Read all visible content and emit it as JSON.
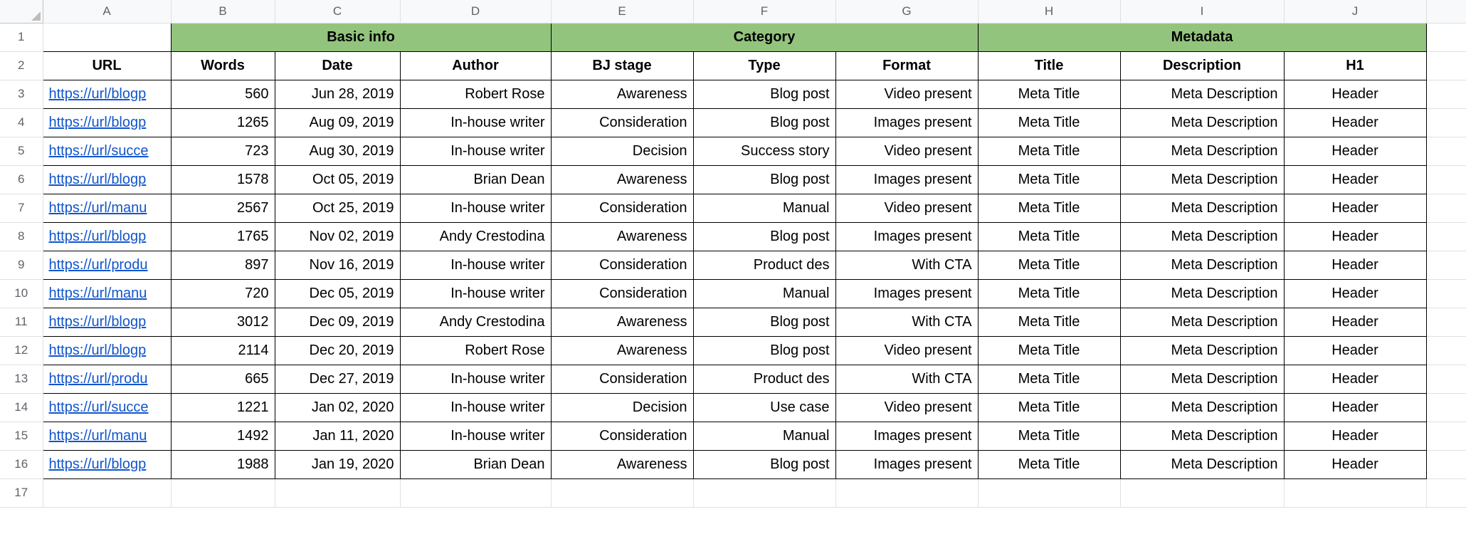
{
  "columns": [
    "A",
    "B",
    "C",
    "D",
    "E",
    "F",
    "G",
    "H",
    "I",
    "J"
  ],
  "groups": [
    {
      "label": "Basic info",
      "span": 3
    },
    {
      "label": "Category",
      "span": 3
    },
    {
      "label": "Metadata",
      "span": 3
    }
  ],
  "headers": {
    "url": "URL",
    "words": "Words",
    "date": "Date",
    "author": "Author",
    "bj_stage": "BJ stage",
    "type": "Type",
    "format": "Format",
    "title": "Title",
    "description": "Description",
    "h1": "H1"
  },
  "chart_data": {
    "type": "table",
    "columns": [
      "URL",
      "Words",
      "Date",
      "Author",
      "BJ stage",
      "Type",
      "Format",
      "Title",
      "Description",
      "H1"
    ],
    "rows": [
      {
        "url": "https://url/blogp",
        "words": 560,
        "date": "Jun 28, 2019",
        "author": "Robert Rose",
        "bj_stage": "Awareness",
        "type": "Blog post",
        "format": "Video present",
        "title": "Meta Title",
        "description": "Meta Description",
        "h1": "Header"
      },
      {
        "url": "https://url/blogp",
        "words": 1265,
        "date": "Aug 09, 2019",
        "author": "In-house writer",
        "bj_stage": "Consideration",
        "type": "Blog post",
        "format": "Images present",
        "title": "Meta Title",
        "description": "Meta Description",
        "h1": "Header"
      },
      {
        "url": "https://url/succe",
        "words": 723,
        "date": "Aug 30, 2019",
        "author": "In-house writer",
        "bj_stage": "Decision",
        "type": "Success story",
        "format": "Video present",
        "title": "Meta Title",
        "description": "Meta Description",
        "h1": "Header"
      },
      {
        "url": "https://url/blogp",
        "words": 1578,
        "date": "Oct 05, 2019",
        "author": "Brian Dean",
        "bj_stage": "Awareness",
        "type": "Blog post",
        "format": "Images present",
        "title": "Meta Title",
        "description": "Meta Description",
        "h1": "Header"
      },
      {
        "url": "https://url/manu",
        "words": 2567,
        "date": "Oct 25, 2019",
        "author": "In-house writer",
        "bj_stage": "Consideration",
        "type": "Manual",
        "format": "Video present",
        "title": "Meta Title",
        "description": "Meta Description",
        "h1": "Header"
      },
      {
        "url": "https://url/blogp",
        "words": 1765,
        "date": "Nov 02, 2019",
        "author": "Andy Crestodina",
        "bj_stage": "Awareness",
        "type": "Blog post",
        "format": "Images present",
        "title": "Meta Title",
        "description": "Meta Description",
        "h1": "Header"
      },
      {
        "url": "https://url/produ",
        "words": 897,
        "date": "Nov 16, 2019",
        "author": "In-house writer",
        "bj_stage": "Consideration",
        "type": "Product des",
        "format": "With CTA",
        "title": "Meta Title",
        "description": "Meta Description",
        "h1": "Header"
      },
      {
        "url": "https://url/manu",
        "words": 720,
        "date": "Dec 05, 2019",
        "author": "In-house writer",
        "bj_stage": "Consideration",
        "type": "Manual",
        "format": "Images present",
        "title": "Meta Title",
        "description": "Meta Description",
        "h1": "Header"
      },
      {
        "url": "https://url/blogp",
        "words": 3012,
        "date": "Dec 09, 2019",
        "author": "Andy Crestodina",
        "bj_stage": "Awareness",
        "type": "Blog post",
        "format": "With CTA",
        "title": "Meta Title",
        "description": "Meta Description",
        "h1": "Header"
      },
      {
        "url": "https://url/blogp",
        "words": 2114,
        "date": "Dec 20, 2019",
        "author": "Robert Rose",
        "bj_stage": "Awareness",
        "type": "Blog post",
        "format": "Video present",
        "title": "Meta Title",
        "description": "Meta Description",
        "h1": "Header"
      },
      {
        "url": "https://url/produ",
        "words": 665,
        "date": "Dec 27, 2019",
        "author": "In-house writer",
        "bj_stage": "Consideration",
        "type": "Product des",
        "format": "With CTA",
        "title": "Meta Title",
        "description": "Meta Description",
        "h1": "Header"
      },
      {
        "url": "https://url/succe",
        "words": 1221,
        "date": "Jan 02, 2020",
        "author": "In-house writer",
        "bj_stage": "Decision",
        "type": "Use case",
        "format": "Video present",
        "title": "Meta Title",
        "description": "Meta Description",
        "h1": "Header"
      },
      {
        "url": "https://url/manu",
        "words": 1492,
        "date": "Jan 11, 2020",
        "author": "In-house writer",
        "bj_stage": "Consideration",
        "type": "Manual",
        "format": "Images present",
        "title": "Meta Title",
        "description": "Meta Description",
        "h1": "Header"
      },
      {
        "url": "https://url/blogp",
        "words": 1988,
        "date": "Jan 19, 2020",
        "author": "Brian Dean",
        "bj_stage": "Awareness",
        "type": "Blog post",
        "format": "Images present",
        "title": "Meta Title",
        "description": "Meta Description",
        "h1": "Header"
      }
    ]
  }
}
